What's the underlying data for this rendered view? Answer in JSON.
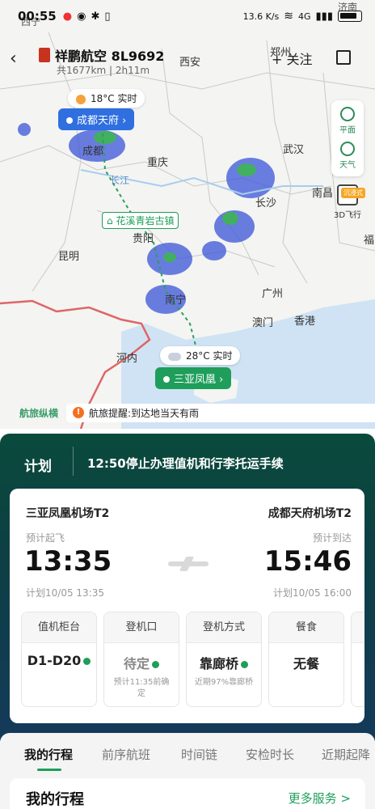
{
  "status": {
    "time": "00:55",
    "speed": "13.6 K/s",
    "net": "4G"
  },
  "header": {
    "flight": "祥鹏航空 8L9692",
    "sub": "共1677km | 2h11m",
    "follow": "+ 关注"
  },
  "map": {
    "cities": [
      "西宁",
      "西安",
      "郑州",
      "济南",
      "成都",
      "重庆",
      "武汉",
      "长沙",
      "南昌",
      "福",
      "昆明",
      "贵阳",
      "南宁",
      "广州",
      "澳门",
      "香港",
      "河内",
      "长江"
    ],
    "origin_weather": "18°C 实时",
    "origin_airport": "成都天府",
    "dest_weather": "28°C 实时",
    "dest_airport": "三亚凤凰",
    "poi": "花溪青岩古镇",
    "tools": {
      "flat": "平面",
      "weather": "天气",
      "fly3d": "3D飞行",
      "tag": "沉浸式"
    }
  },
  "notice": {
    "brand": "航旅纵横",
    "text": "航旅提醒:到达地当天有雨"
  },
  "plan": {
    "label": "计划",
    "text": "12:50停止办理值机和行李托运手续"
  },
  "flight": {
    "dep_airport": "三亚凤凰机场T2",
    "arr_airport": "成都天府机场T2",
    "dep_label": "预计起飞",
    "arr_label": "预计到达",
    "dep_time": "13:35",
    "arr_time": "15:46",
    "dep_plan": "计划10/05 13:35",
    "arr_plan": "计划10/05 16:00"
  },
  "info": [
    {
      "title": "值机柜台",
      "value": "D1-D20",
      "note": ""
    },
    {
      "title": "登机口",
      "value": "待定",
      "note": "预计11:35前确定"
    },
    {
      "title": "登机方式",
      "value": "靠廊桥",
      "note": "近期97%靠廊桥"
    },
    {
      "title": "餐食",
      "value": "无餐",
      "note": ""
    }
  ],
  "tabs": [
    "我的行程",
    "前序航班",
    "时间链",
    "安检时长",
    "近期起降"
  ],
  "section": {
    "title": "我的行程",
    "more": "更多服务 >"
  }
}
